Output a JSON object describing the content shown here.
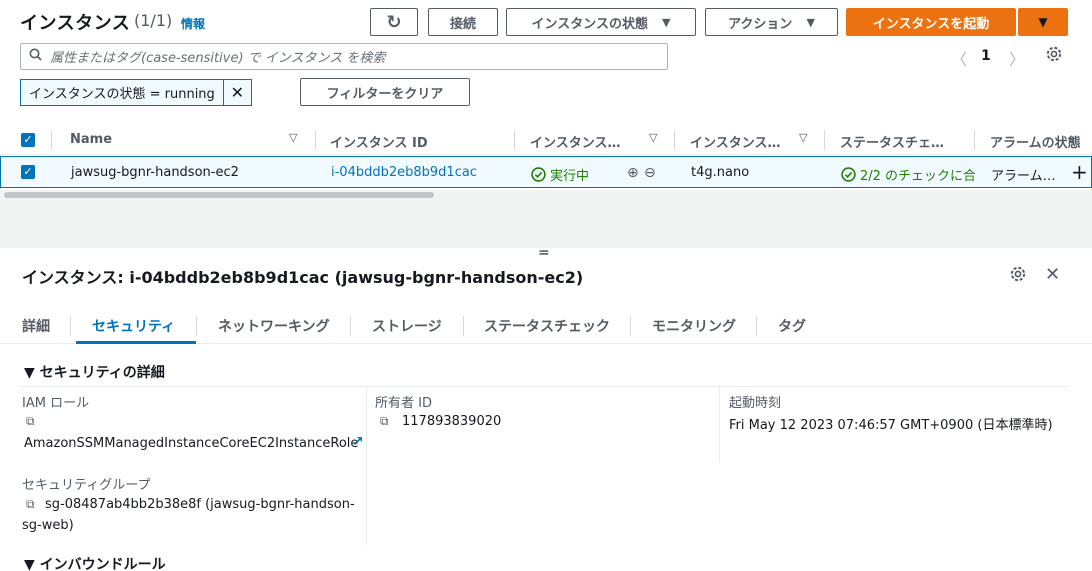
{
  "header": {
    "title": "インスタンス",
    "count": "(1/1)",
    "info": "情報",
    "refresh_icon": "↻",
    "connect_label": "接続",
    "instance_state_label": "インスタンスの状態",
    "actions_label": "アクション",
    "launch_label": "インスタンスを起動",
    "dropdown_glyph": "▼"
  },
  "search": {
    "placeholder": "属性またはタグ(case-sensitive) で インスタンス を検索",
    "icon": "search-icon"
  },
  "pagination": {
    "prev": "〈",
    "page": "1",
    "next": "〉"
  },
  "filter": {
    "token": "インスタンスの状態 = running",
    "remove": "✕",
    "clear_label": "フィルターをクリア"
  },
  "table": {
    "columns": [
      "Name",
      "インスタンス ID",
      "インスタンス…",
      "インスタンス…",
      "ステータスチェ…",
      "アラームの状態"
    ],
    "rows": [
      {
        "name": "jawsug-bgnr-handson-ec2",
        "instance_id": "i-04bddb2eb8b9d1cac",
        "state": "実行中",
        "type": "t4g.nano",
        "status_check": "2/2 のチェックに合",
        "alarm": "アラーム…",
        "add": "+"
      }
    ],
    "check_glyph": "✓",
    "sort_glyph": "▽",
    "ok_glyph": "✓",
    "zoom_in": "⊕",
    "zoom_out": "⊖"
  },
  "detail": {
    "grip": "=",
    "title": "インスタンス: i-04bddb2eb8b9d1cac (jawsug-bgnr-handson-ec2)",
    "close": "✕",
    "tabs": [
      "詳細",
      "セキュリティ",
      "ネットワーキング",
      "ストレージ",
      "ステータスチェック",
      "モニタリング",
      "タグ"
    ],
    "active_tab": "セキュリティ",
    "security_section": "▼ セキュリティの詳細",
    "iam_label": "IAM ロール",
    "iam_value": "AmazonSSMManagedInstanceCoreEC2InstanceRole",
    "owner_label": "所有者 ID",
    "owner_value": "117893839020",
    "launch_label": "起動時刻",
    "launch_value": "Fri May 12 2023 07:46:57 GMT+0900 (日本標準時)",
    "sg_label": "セキュリティグループ",
    "sg_value_line1": "sg-08487ab4bb2b38e8f (jawsug-bgnr-handson-",
    "sg_value_line2": "sg-web)",
    "inbound_section": "▼ インバウンドルール",
    "copy_glyph": "⧉",
    "external_glyph": "↗"
  },
  "colors": {
    "accent": "#0073bb",
    "primary_button": "#ec7211",
    "success": "#1d8102"
  }
}
